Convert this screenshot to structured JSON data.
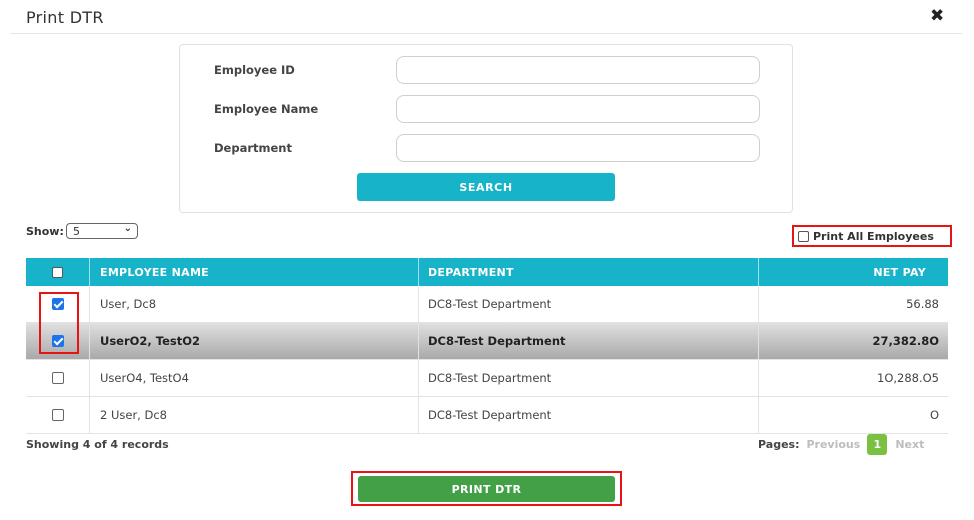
{
  "dialog": {
    "title": "Print DTR",
    "close_glyph": "✖"
  },
  "search": {
    "employee_id_label": "Employee ID",
    "employee_id_value": "",
    "employee_name_label": "Employee Name",
    "employee_name_value": "",
    "department_label": "Department",
    "department_value": "",
    "search_button": "SEARCH"
  },
  "show": {
    "label": "Show:",
    "selected": "5"
  },
  "print_all": {
    "label": "Print All Employees",
    "checked": false
  },
  "table": {
    "columns": [
      "EMPLOYEE NAME",
      "DEPARTMENT",
      "NET PAY"
    ],
    "rows": [
      {
        "name": "User, Dc8",
        "department": "DC8-Test Department",
        "net_pay": "56.88",
        "checked": true
      },
      {
        "name": "UserO2, TestO2",
        "department": "DC8-Test Department",
        "net_pay": "27,382.8O",
        "checked": true
      },
      {
        "name": "UserO4, TestO4",
        "department": "DC8-Test Department",
        "net_pay": "1O,288.O5",
        "checked": false
      },
      {
        "name": "2 User, Dc8",
        "department": "DC8-Test Department",
        "net_pay": "O",
        "checked": false
      }
    ]
  },
  "footer": {
    "records_text": "Showing 4 of 4 records",
    "pages_label": "Pages:",
    "previous": "Previous",
    "current_page": "1",
    "next": "Next"
  },
  "print_button": "PRINT DTR",
  "colors": {
    "accent": "#17b3c8",
    "print_green": "#43a047",
    "page_green": "#7ac142",
    "highlight_red": "#e51515",
    "checkbox_blue": "#1c74e8"
  }
}
